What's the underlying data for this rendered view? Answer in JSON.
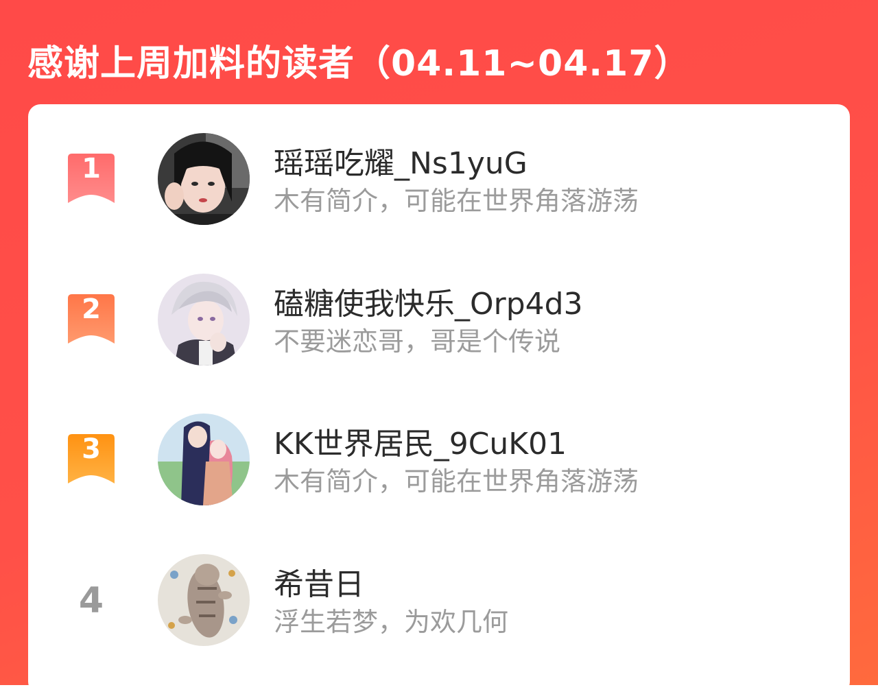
{
  "header": {
    "title": "感谢上周加料的读者（04.11~04.17）"
  },
  "colors": {
    "banner": "#ff4a48",
    "rank1": "#ff5a5e",
    "rank2": "#ff7a52",
    "rank3": "#ff9a1e",
    "rank_plain": "#9a9a9a"
  },
  "readers": [
    {
      "rank": "1",
      "name": "瑶瑶吃耀_Ns1yuG",
      "bio": "木有简介，可能在世界角落游荡",
      "avatar": "avatar-girl-black-hair"
    },
    {
      "rank": "2",
      "name": "磕糖使我快乐_Orp4d3",
      "bio": "不要迷恋哥，哥是个传说",
      "avatar": "avatar-anime-white-hair"
    },
    {
      "rank": "3",
      "name": "KK世界居民_9CuK01",
      "bio": "木有简介，可能在世界角落游荡",
      "avatar": "avatar-anime-couple"
    },
    {
      "rank": "4",
      "name": "希昔日",
      "bio": "浮生若梦，为欢几何",
      "avatar": "avatar-cat"
    }
  ]
}
